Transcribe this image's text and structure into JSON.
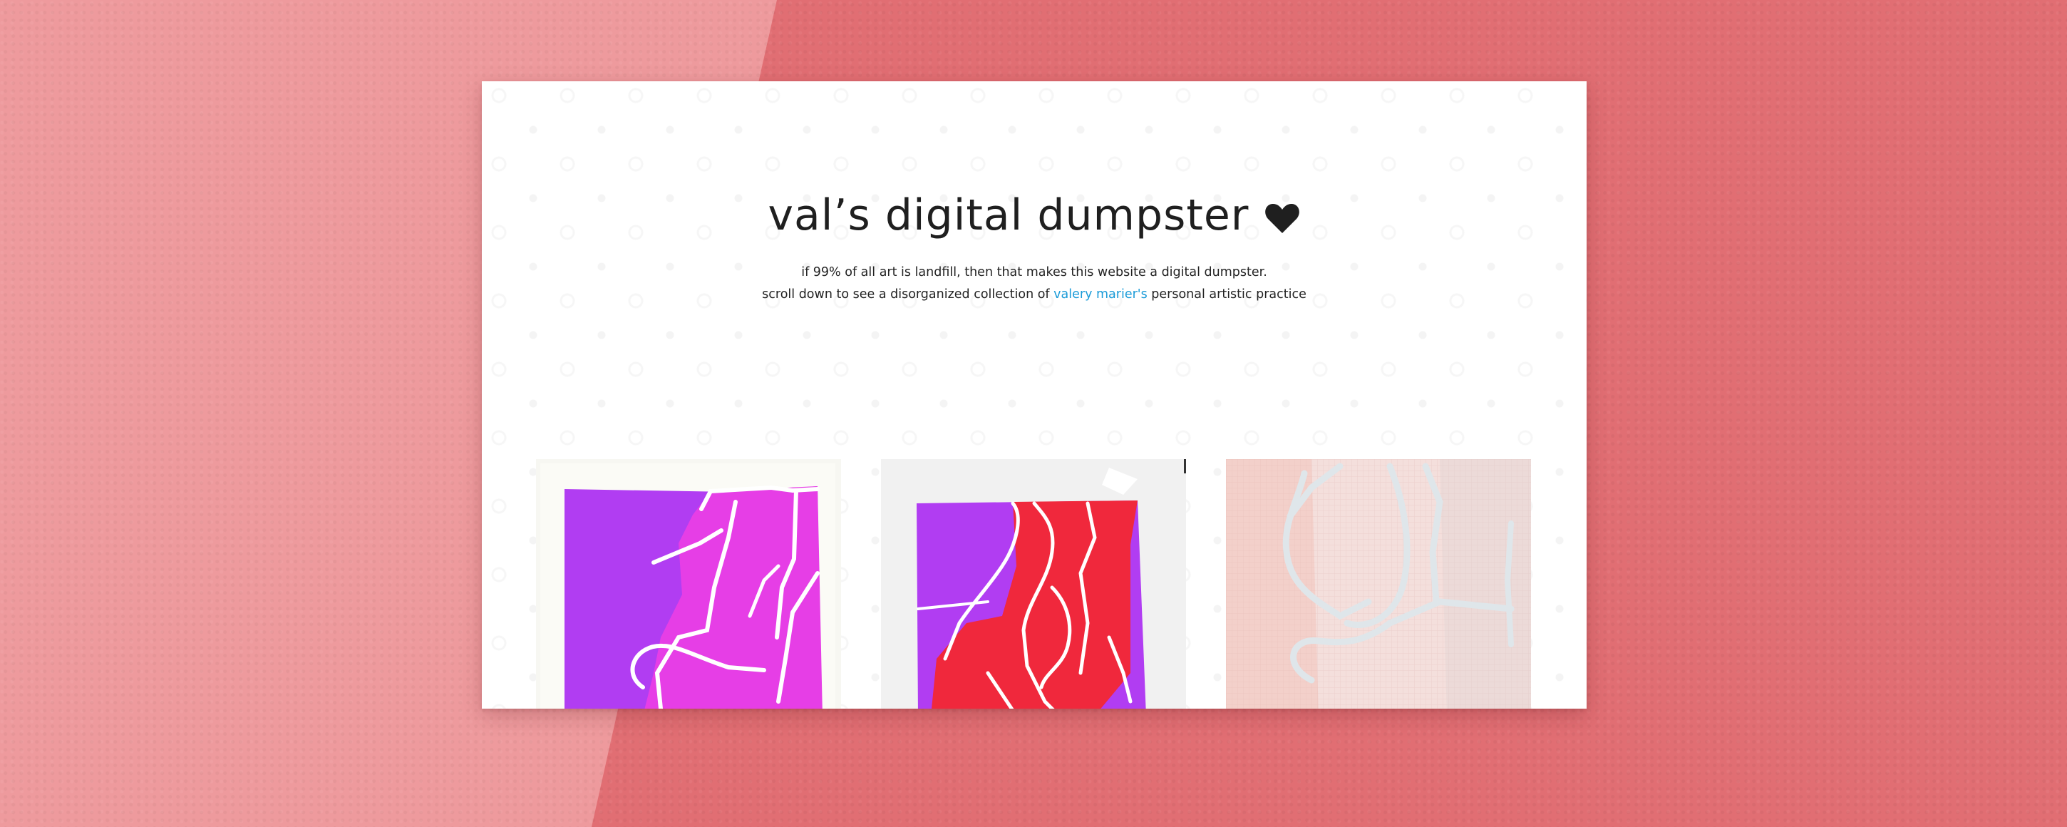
{
  "site": {
    "title": "val’s digital dumpster",
    "title_icon": "heart-icon",
    "tagline_line1": "if 99% of all art is landfill, then that makes this website a digital dumpster.",
    "tagline_line2_before": "scroll down to see a disorganized collection of ",
    "artist_link": "valery marier's",
    "tagline_line2_after": " personal artistic practice"
  },
  "colors": {
    "backdrop": "#e16e73",
    "backdrop_light": "#ee9a9d",
    "link": "#1a9bd8",
    "title": "#1f1f1f"
  },
  "gallery": {
    "items": [
      {
        "name": "artwork-purple-magenta-figure",
        "palette": [
          "#b13df2",
          "#e63ee6",
          "#ffffff"
        ]
      },
      {
        "name": "artwork-red-purple-figure",
        "palette": [
          "#b13df2",
          "#f0283c",
          "#ffffff"
        ]
      },
      {
        "name": "artwork-pale-pink-figure",
        "palette": [
          "#f2dada",
          "#dde2e6",
          "#ffffff"
        ]
      }
    ]
  }
}
